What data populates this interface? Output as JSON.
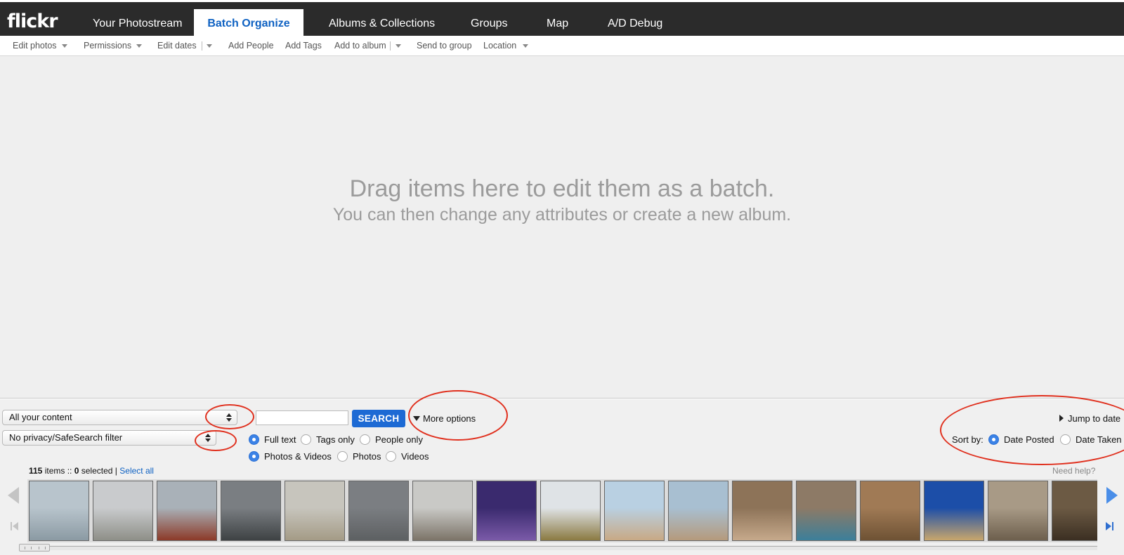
{
  "header": {
    "logo": "flickr",
    "tabs": [
      {
        "label": "Your Photostream",
        "active": false
      },
      {
        "label": "Batch Organize",
        "active": true
      },
      {
        "label": "Albums & Collections",
        "active": false
      },
      {
        "label": "Groups",
        "active": false
      },
      {
        "label": "Map",
        "active": false
      },
      {
        "label": "A/D Debug",
        "active": false
      }
    ]
  },
  "toolbar": {
    "items": [
      "Edit photos",
      "Permissions",
      "Edit dates",
      "Add People",
      "Add Tags",
      "Add to album",
      "Send to group",
      "Location"
    ]
  },
  "dropzone": {
    "line1": "Drag items here to edit them as a batch.",
    "line2": "You can then change any attributes or create a new album."
  },
  "search": {
    "content_select": "All your content",
    "filter_select": "No privacy/SafeSearch filter",
    "query_value": "",
    "button_label": "SEARCH",
    "more_options": "More options",
    "scope": {
      "options": [
        "Full text",
        "Tags only",
        "People only"
      ],
      "selected": "Full text"
    },
    "media": {
      "options": [
        "Photos & Videos",
        "Photos",
        "Videos"
      ],
      "selected": "Photos & Videos"
    }
  },
  "sort": {
    "jump_label": "Jump to date",
    "label": "Sort by:",
    "options": [
      "Date Posted",
      "Date Taken"
    ],
    "selected": "Date Posted"
  },
  "status": {
    "items_count": "115",
    "items_label": "items ::",
    "selected_count": "0",
    "selected_label": "selected",
    "separator": "|",
    "select_all": "Select all",
    "help": "Need help?"
  },
  "filmstrip": {
    "thumbnails": [
      {
        "name": "ferry-boat-thumb",
        "colors": [
          "#b8c4cc",
          "#8b9aa3"
        ]
      },
      {
        "name": "beach-grey-thumb",
        "colors": [
          "#c9cbcd",
          "#8e8f88"
        ]
      },
      {
        "name": "lighthouse-thumb",
        "colors": [
          "#a9b1b8",
          "#8c3a28"
        ]
      },
      {
        "name": "dusk-path-thumb",
        "colors": [
          "#7a7e82",
          "#3e4244"
        ]
      },
      {
        "name": "dunes-thumb",
        "colors": [
          "#c7c5bd",
          "#a49b86"
        ]
      },
      {
        "name": "cloudy-beach-thumb",
        "colors": [
          "#7b7e82",
          "#5d6062"
        ]
      },
      {
        "name": "sun-beach-thumb",
        "colors": [
          "#c9c9c6",
          "#7c7468"
        ]
      },
      {
        "name": "aquarium-thumb",
        "colors": [
          "#3a2a6e",
          "#7a5aa8"
        ]
      },
      {
        "name": "old-boat-thumb",
        "colors": [
          "#dfe3e6",
          "#8b7a42"
        ]
      },
      {
        "name": "waves-rock-thumb",
        "colors": [
          "#b9d0e2",
          "#c8a985"
        ]
      },
      {
        "name": "waves-beach-thumb",
        "colors": [
          "#a8bfd1",
          "#b59a7c"
        ]
      },
      {
        "name": "sea-cave-thumb",
        "colors": [
          "#8d7358",
          "#c6a98b"
        ]
      },
      {
        "name": "blue-cave-thumb",
        "colors": [
          "#8d7a66",
          "#3c7f9a"
        ]
      },
      {
        "name": "cave-arch-thumb",
        "colors": [
          "#a07a55",
          "#6e5234"
        ]
      },
      {
        "name": "blue-sky-cliff-thumb",
        "colors": [
          "#1c4ea8",
          "#c8a66c"
        ]
      },
      {
        "name": "cliff-water-thumb",
        "colors": [
          "#a89a86",
          "#6d5f4d"
        ]
      },
      {
        "name": "cave-edge-thumb",
        "colors": [
          "#6c5a44",
          "#3b2f22"
        ]
      }
    ]
  }
}
